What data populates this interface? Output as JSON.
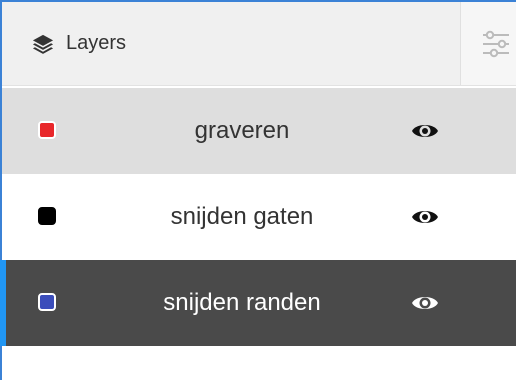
{
  "panel": {
    "title": "Layers",
    "title_icon": "layers-icon",
    "filter_icon": "sliders-icon"
  },
  "layers": [
    {
      "name": "graveren",
      "color": "#e8272a",
      "swatch_border": "#ffffff",
      "visible_icon": "eye-icon",
      "text_color": "#333333",
      "eye_color": "#111111",
      "row_bg": "#dedede",
      "selected": false
    },
    {
      "name": "snijden gaten",
      "color": "#000000",
      "swatch_border": "#000000",
      "visible_icon": "eye-icon",
      "text_color": "#333333",
      "eye_color": "#111111",
      "row_bg": "#ffffff",
      "selected": false
    },
    {
      "name": "snijden randen",
      "color": "#3b4dbb",
      "swatch_border": "#ffffff",
      "visible_icon": "eye-icon",
      "text_color": "#ffffff",
      "eye_color": "#ffffff",
      "row_bg": "#4a4a4a",
      "selected": true
    }
  ],
  "accent_color": "#2196f3"
}
